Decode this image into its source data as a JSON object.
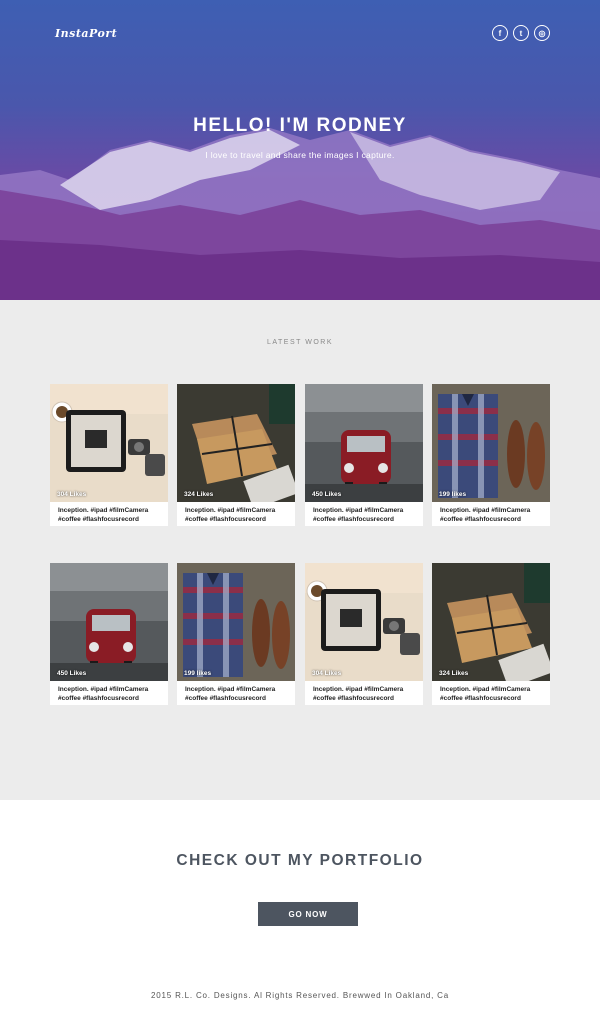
{
  "header": {
    "logo": "InstaPort",
    "social": [
      {
        "icon": "facebook-icon",
        "glyph": "f"
      },
      {
        "icon": "twitter-icon",
        "glyph": "t"
      },
      {
        "icon": "instagram-icon",
        "glyph": "◎"
      }
    ]
  },
  "hero": {
    "title": "HELLO! I'M RODNEY",
    "subtitle": "I love to travel and share the images I capture."
  },
  "work": {
    "label": "LATEST WORK",
    "cards": [
      {
        "likes": "304 Likes",
        "caption1": "Inception. #ipad #filmCamera",
        "caption2": "#coffee #flashfocusrecord",
        "image": "ipad-camera"
      },
      {
        "likes": "324 Likes",
        "caption1": "Inception. #ipad #filmCamera",
        "caption2": "#coffee #flashfocusrecord",
        "image": "books-parcel"
      },
      {
        "likes": "450 Likes",
        "caption1": "Inception. #ipad #filmCamera",
        "caption2": "#coffee #flashfocusrecord",
        "image": "vw-bus"
      },
      {
        "likes": "199 likes",
        "caption1": "Inception. #ipad #filmCamera",
        "caption2": "#coffee #flashfocusrecord",
        "image": "shirt-shoes"
      },
      {
        "likes": "450 Likes",
        "caption1": "Inception. #ipad #filmCamera",
        "caption2": "#coffee #flashfocusrecord",
        "image": "vw-bus"
      },
      {
        "likes": "199 likes",
        "caption1": "Inception. #ipad #filmCamera",
        "caption2": "#coffee #flashfocusrecord",
        "image": "shirt-shoes"
      },
      {
        "likes": "304 Likes",
        "caption1": "Inception. #ipad #filmCamera",
        "caption2": "#coffee #flashfocusrecord",
        "image": "ipad-camera"
      },
      {
        "likes": "324 Likes",
        "caption1": "Inception. #ipad #filmCamera",
        "caption2": "#coffee #flashfocusrecord",
        "image": "books-parcel"
      }
    ]
  },
  "cta": {
    "title": "CHECK OUT MY PORTFOLIO",
    "button": "GO NOW"
  },
  "footer": {
    "text": "2015 R.L. Co. Designs. Al Rights Reserved. Brewwed In Oakland, Ca"
  },
  "colors": {
    "hero_top": "#3e5fb3",
    "hero_bottom": "#6d3d98",
    "section_bg": "#ececec",
    "dark_slate": "#4d5560"
  }
}
